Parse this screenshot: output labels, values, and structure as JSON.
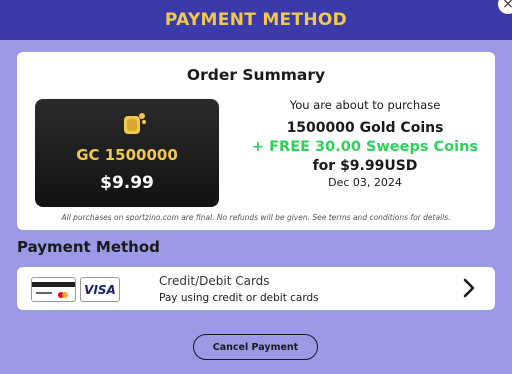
{
  "header": {
    "title": "PAYMENT METHOD",
    "close_icon": "close-icon"
  },
  "order_summary": {
    "title": "Order Summary",
    "product": {
      "icon": "gold-coin-icon",
      "gc_label": "GC 1500000",
      "price": "$9.99"
    },
    "purchase_intro": "You are about to purchase",
    "gold_coins": "1500000 Gold Coins",
    "bonus": "+ FREE 30.00 Sweeps Coins",
    "price_line": "for $9.99USD",
    "date": "Dec 03, 2024",
    "disclaimer": "All purchases on sportzino.com are final. No refunds will be given. See terms and conditions for details."
  },
  "payment_method": {
    "heading": "Payment Method",
    "option": {
      "title": "Credit/Debit Cards",
      "subtitle": "Pay using credit or debit cards",
      "visa_text": "VISA",
      "icons": [
        "credit-card-icon",
        "visa-card-icon",
        "chevron-right-icon"
      ]
    }
  },
  "actions": {
    "cancel_label": "Cancel Payment"
  },
  "colors": {
    "background": "#9c9ae6",
    "header": "#3a3aab",
    "gold": "#f2c94c",
    "green": "#2ed15a"
  }
}
